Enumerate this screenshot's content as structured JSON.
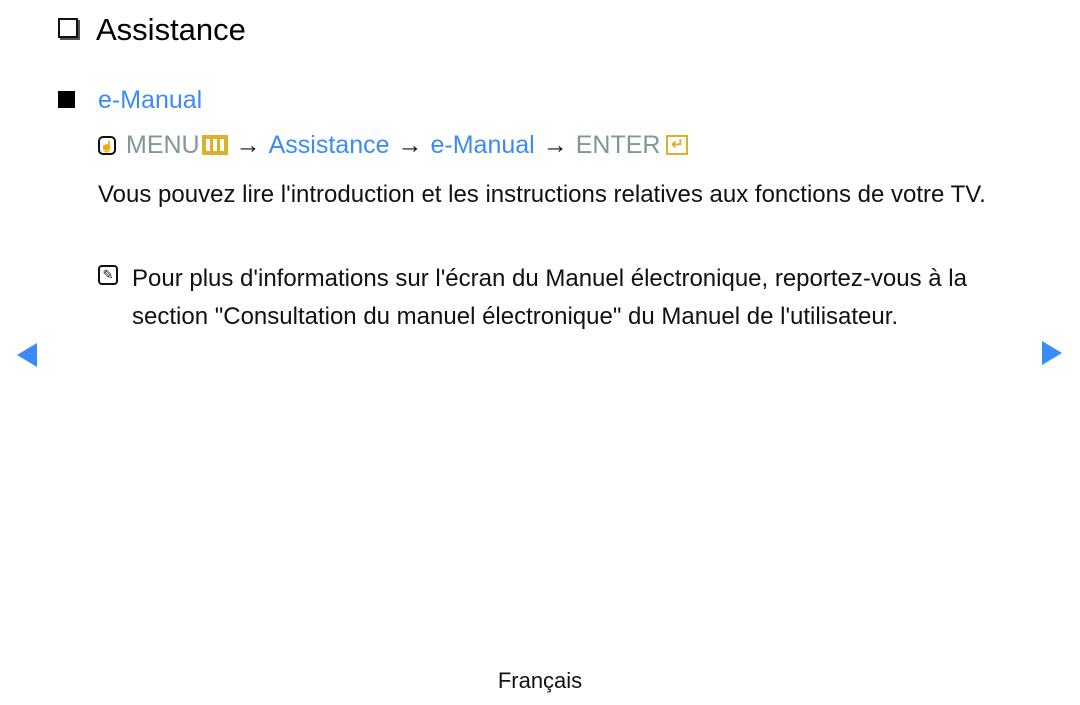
{
  "heading": {
    "title": "Assistance",
    "icon": "checkbox-outline-icon"
  },
  "section": {
    "title": "e-Manual",
    "icon": "filled-square-icon"
  },
  "menu_path": {
    "remote_icon": "remote-button-icon",
    "menu_label": "MENU",
    "menu_icon": "menu-button-icon",
    "arrow": "→",
    "step1": "Assistance",
    "step2": "e-Manual",
    "enter_label": "ENTER",
    "enter_icon": "enter-button-icon"
  },
  "description": "Vous pouvez lire l'introduction et les instructions relatives aux fonctions de votre TV.",
  "note": {
    "icon": "note-pencil-icon",
    "text": "Pour plus d'informations sur l'écran du Manuel électronique, reportez-vous à la section \"Consultation du manuel électronique\" du Manuel de l'utilisateur."
  },
  "navigation": {
    "prev": "previous-page-arrow",
    "next": "next-page-arrow"
  },
  "footer": {
    "language": "Français"
  },
  "colors": {
    "link_blue": "#3b8bf6",
    "key_gray": "#7f979b",
    "key_gold": "#dcb028"
  }
}
